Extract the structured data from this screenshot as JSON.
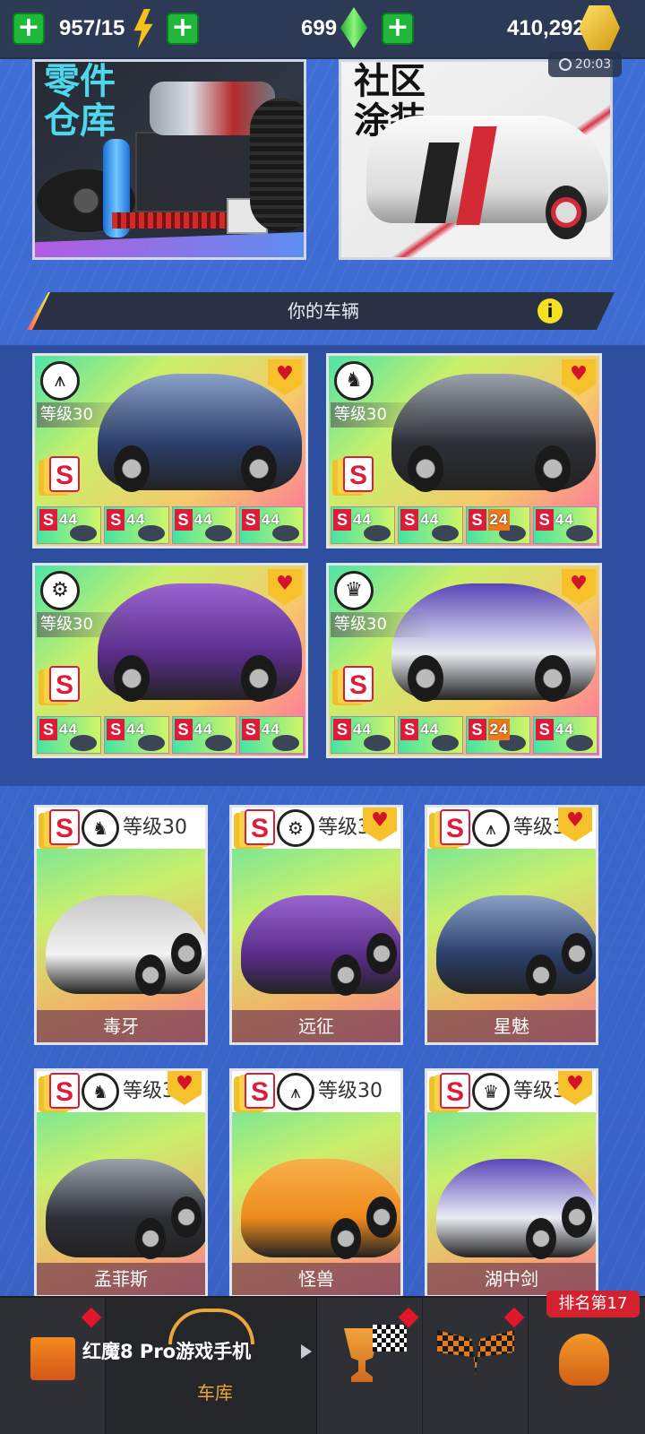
{
  "topbar": {
    "energy": "957/15",
    "gems": "699",
    "coins": "410,292",
    "timer": "20:03",
    "colors": {
      "plus": "#1fb83a",
      "energy": "#f5c21c",
      "gem": "#3ddc4a",
      "coin": "#e9b21a"
    }
  },
  "banners": {
    "parts_title_line1": "零件",
    "parts_title_line2": "仓库",
    "livery_title_line1": "社区",
    "livery_title_line2": "涂装"
  },
  "section": {
    "title": "你的车辆",
    "info_icon": "i"
  },
  "featured_cars": [
    {
      "class_icon": "road-icon",
      "level": "等级30",
      "favorite": true,
      "parts": [
        {
          "grade": "S",
          "value": "44"
        },
        {
          "grade": "S",
          "value": "44"
        },
        {
          "grade": "S",
          "value": "44"
        },
        {
          "grade": "S",
          "value": "44"
        }
      ]
    },
    {
      "class_icon": "horse-icon",
      "level": "等级30",
      "favorite": true,
      "parts": [
        {
          "grade": "S",
          "value": "44"
        },
        {
          "grade": "S",
          "value": "44"
        },
        {
          "grade": "S",
          "value": "24"
        },
        {
          "grade": "S",
          "value": "44"
        }
      ]
    },
    {
      "class_icon": "wheel-icon",
      "level": "等级30",
      "favorite": true,
      "parts": [
        {
          "grade": "S",
          "value": "44"
        },
        {
          "grade": "S",
          "value": "44"
        },
        {
          "grade": "S",
          "value": "44"
        },
        {
          "grade": "S",
          "value": "44"
        }
      ]
    },
    {
      "class_icon": "crown-icon",
      "level": "等级30",
      "favorite": true,
      "parts": [
        {
          "grade": "S",
          "value": "44"
        },
        {
          "grade": "S",
          "value": "44"
        },
        {
          "grade": "S",
          "value": "24"
        },
        {
          "grade": "S",
          "value": "44"
        }
      ]
    }
  ],
  "cars": [
    {
      "name": "毒牙",
      "level": "等级30",
      "class_icon": "horse-icon",
      "favorite": false
    },
    {
      "name": "远征",
      "level": "等级3",
      "class_icon": "wheel-icon",
      "favorite": true
    },
    {
      "name": "星魅",
      "level": "等级3",
      "class_icon": "road-icon",
      "favorite": true
    },
    {
      "name": "孟菲斯",
      "level": "等级3",
      "class_icon": "horse-icon",
      "favorite": true
    },
    {
      "name": "怪兽",
      "level": "等级30",
      "class_icon": "road-icon",
      "favorite": false
    },
    {
      "name": "湖中剑",
      "level": "等级3",
      "class_icon": "crown-icon",
      "favorite": true
    }
  ],
  "bottomnav": {
    "promo_text": "红魔8 Pro游戏手机",
    "garage_label": "车库",
    "rank_label": "排名第17"
  }
}
